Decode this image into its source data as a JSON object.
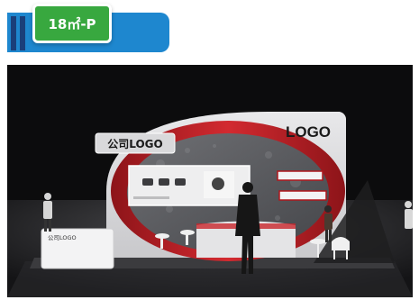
{
  "badge": {
    "label": "18㎡-P",
    "accent_green": "#38a83f",
    "accent_blue": "#1e87cf"
  },
  "booth": {
    "company_logo_sign": "公司LOGO",
    "top_logo": "LOGO",
    "reception_counter_text": "公司LOGO",
    "accent_red": "#c8262c"
  }
}
